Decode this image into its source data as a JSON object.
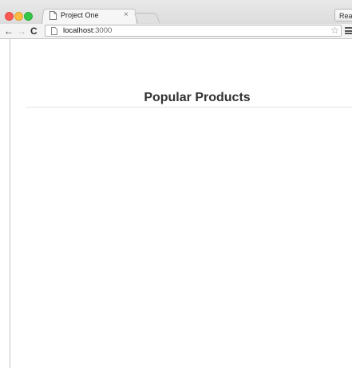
{
  "browser": {
    "tab": {
      "title": "Project One",
      "close_glyph": "×"
    },
    "extension_button_label": "React",
    "nav": {
      "back": "←",
      "forward": "→",
      "reload": "C"
    },
    "address": {
      "host": "localhost",
      "port": ":3000"
    },
    "bookmark_glyph": "☆"
  },
  "page": {
    "heading": "Popular Products"
  },
  "colors": {
    "close": "#fc5753",
    "minimize": "#fdbc40",
    "maximize": "#33c748"
  }
}
